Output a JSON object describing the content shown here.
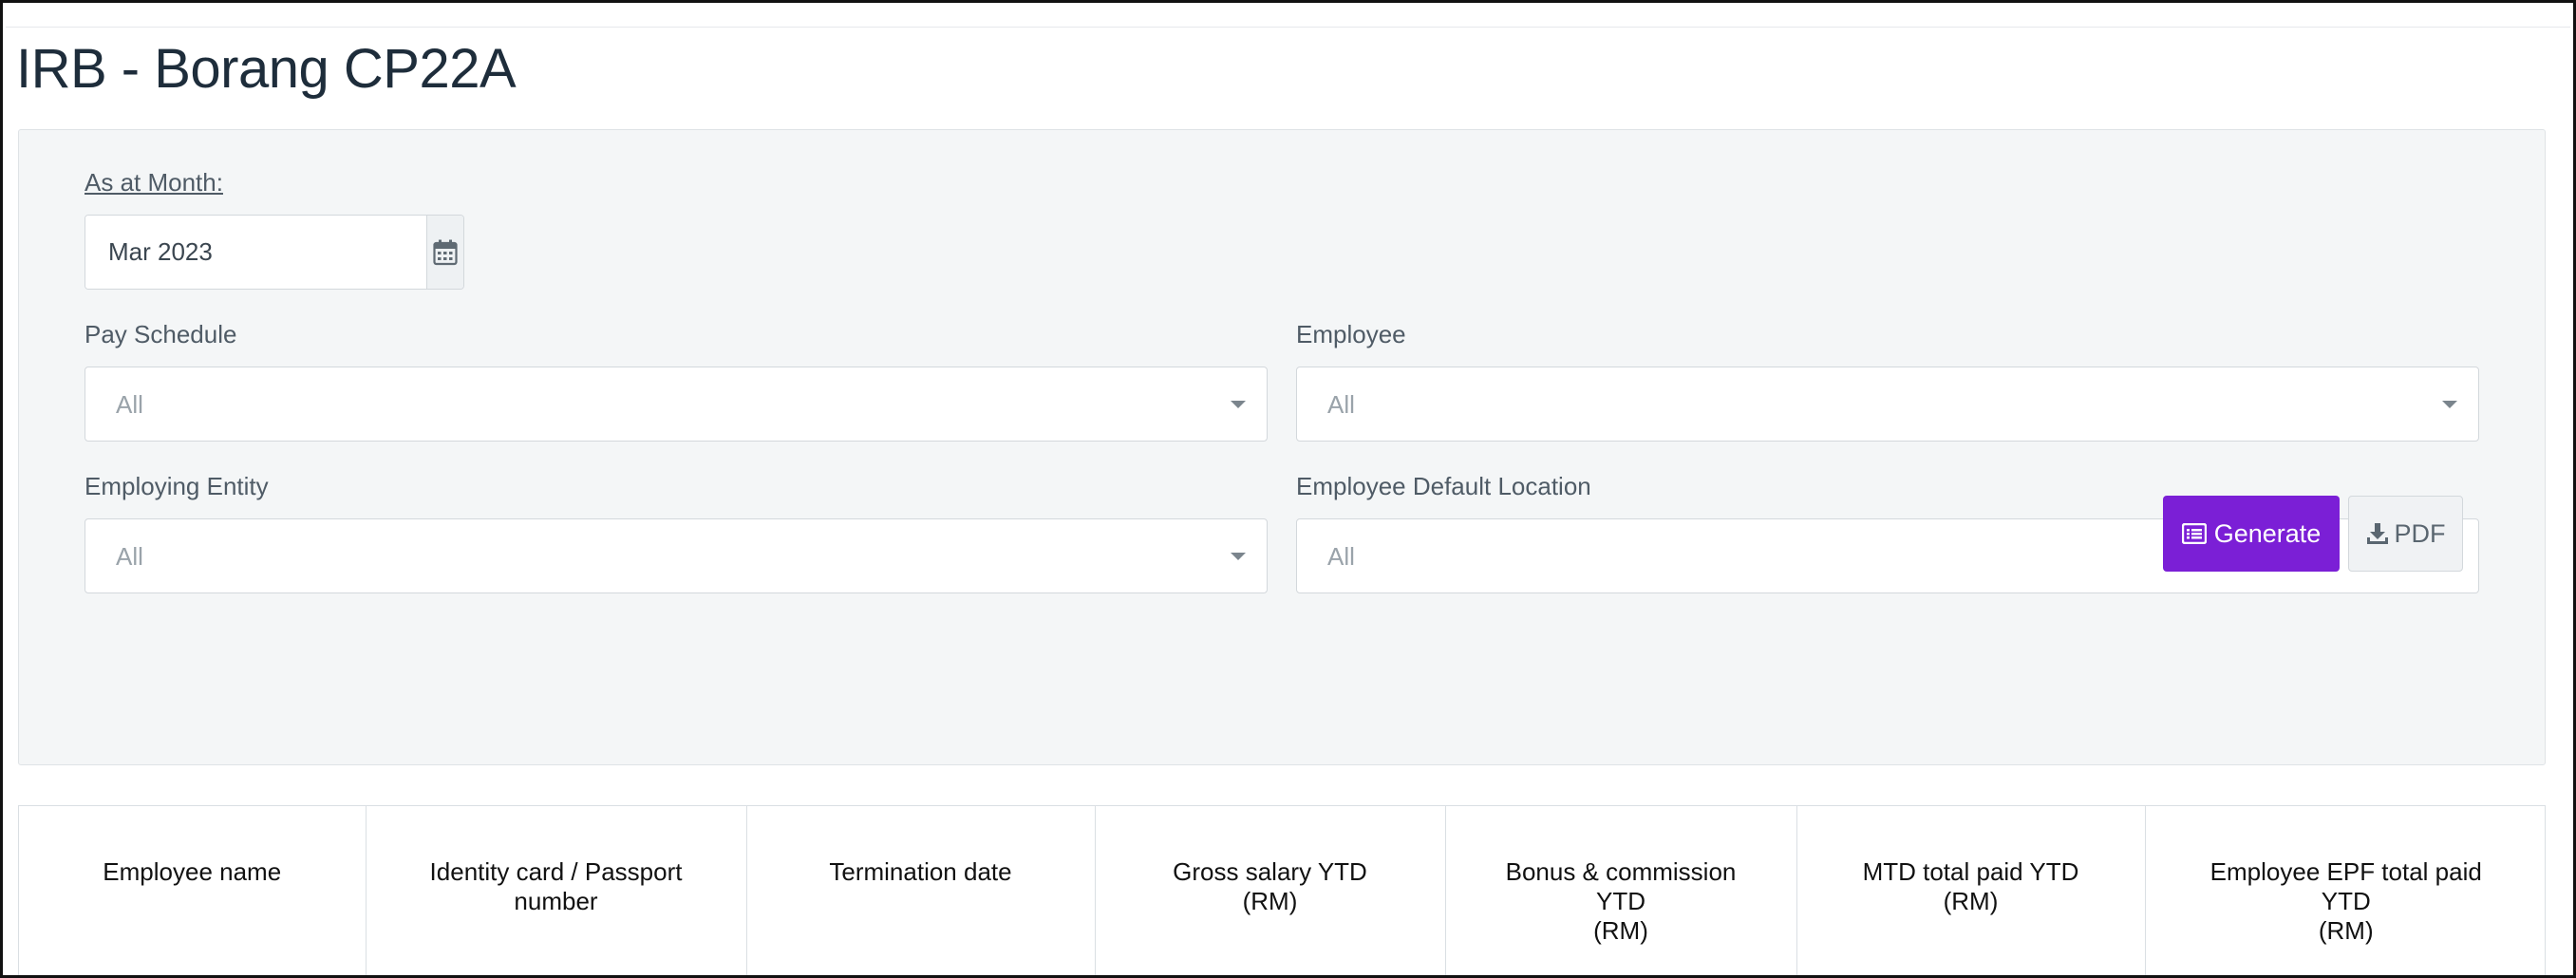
{
  "page": {
    "title": "IRB - Borang CP22A"
  },
  "filters": {
    "month_label": "As at Month:",
    "month_value": "Mar 2023",
    "pay_schedule": {
      "label": "Pay Schedule",
      "value": "All"
    },
    "employee": {
      "label": "Employee",
      "value": "All"
    },
    "employing_entity": {
      "label": "Employing Entity",
      "value": "All"
    },
    "default_location": {
      "label": "Employee Default Location",
      "value": "All"
    }
  },
  "actions": {
    "generate_label": "Generate",
    "pdf_label": "PDF"
  },
  "table": {
    "columns": [
      "Employee name",
      "Identity card / Passport\nnumber",
      "Termination date",
      "Gross salary YTD\n(RM)",
      "Bonus & commission\nYTD\n(RM)",
      "MTD total paid YTD\n(RM)",
      "Employee EPF total paid\nYTD\n(RM)"
    ]
  },
  "colors": {
    "accent": "#7b1fd6",
    "panel": "#f4f6f7"
  },
  "icons": [
    "calendar-icon",
    "chevron-down-icon",
    "list-icon",
    "download-icon"
  ]
}
